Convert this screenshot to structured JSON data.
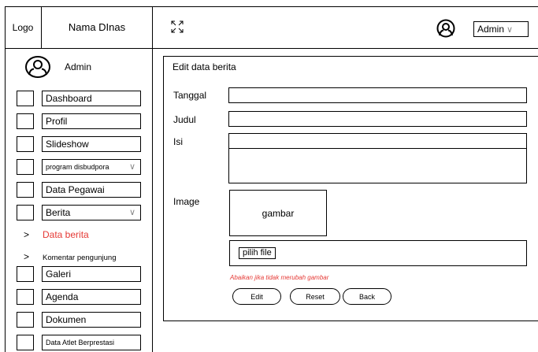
{
  "header": {
    "logo": "Logo",
    "dinas": "Nama DInas",
    "user_menu": "Admin",
    "icons": {
      "fullscreen": "expand-icon",
      "avatar": "user-avatar-icon",
      "dropdown": "chevron-down-icon"
    }
  },
  "sidebar": {
    "user": "Admin",
    "items": [
      {
        "label": "Dashboard"
      },
      {
        "label": "Profil"
      },
      {
        "label": "Slideshow"
      },
      {
        "label": "program disbudpora"
      },
      {
        "label": "Data Pegawai"
      },
      {
        "label": "Berita"
      }
    ],
    "subitems": [
      {
        "label": "Data berita",
        "arrow": ">"
      },
      {
        "label": "Komentar pengunjung",
        "arrow": ">"
      }
    ],
    "items_after": [
      {
        "label": "Galeri"
      },
      {
        "label": "Agenda"
      },
      {
        "label": "Dokumen"
      },
      {
        "label": "Data Atlet Berprestasi"
      }
    ]
  },
  "form": {
    "title": "Edit data berita",
    "labels": {
      "tanggal": "Tanggal",
      "judul": "Judul",
      "isi": "Isi",
      "image": "Image"
    },
    "image_placeholder": "gambar",
    "file_button": "pilih file",
    "note": "Abaikan jika tidak merubah gambar",
    "buttons": {
      "edit": "Edit",
      "reset": "Reset",
      "back": "Back"
    }
  },
  "colors": {
    "accent": "#e53935",
    "border": "#000000",
    "muted": "#888888"
  }
}
